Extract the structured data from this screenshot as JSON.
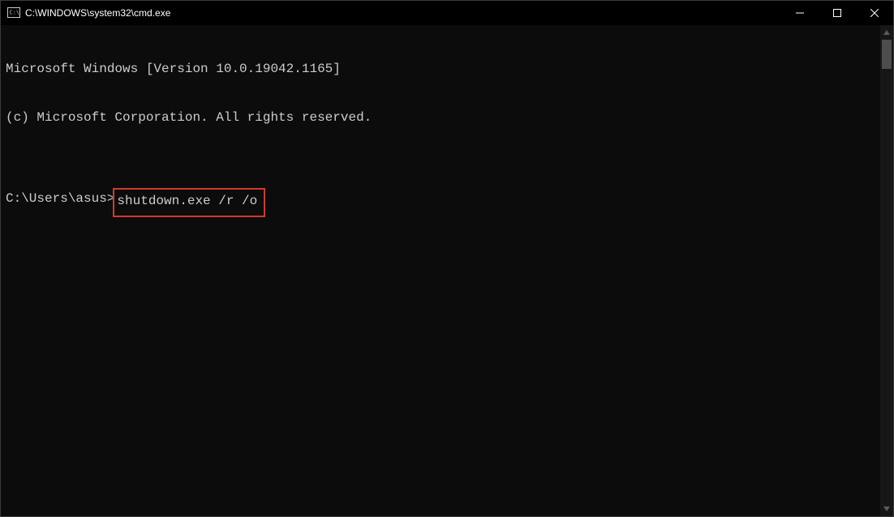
{
  "titlebar": {
    "title": "C:\\WINDOWS\\system32\\cmd.exe"
  },
  "console": {
    "line1": "Microsoft Windows [Version 10.0.19042.1165]",
    "line2": "(c) Microsoft Corporation. All rights reserved.",
    "blank": "",
    "prompt": "C:\\Users\\asus>",
    "typed_command": "shutdown.exe /r /o"
  },
  "annotation": {
    "highlight_color": "#d23a2a"
  }
}
